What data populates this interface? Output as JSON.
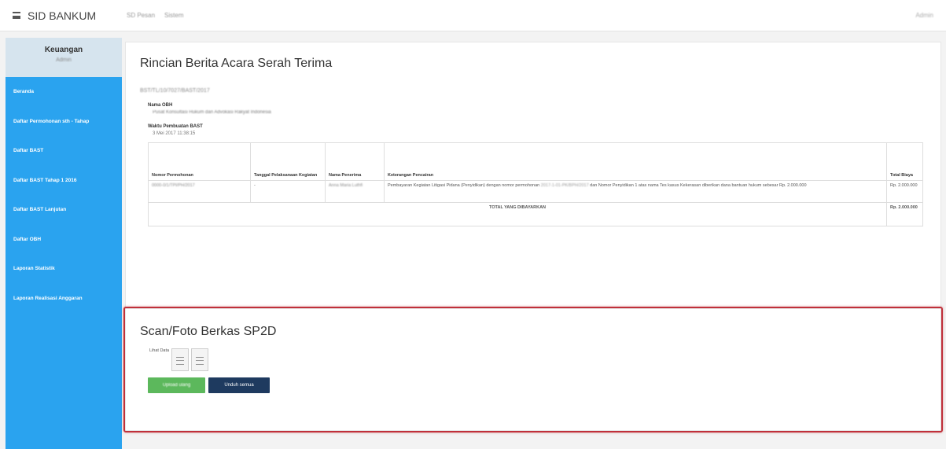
{
  "app": {
    "brand": "SID BANKUM"
  },
  "topnav": {
    "items": [
      "SD Pesan",
      "Sistem"
    ]
  },
  "user": {
    "name": "Admin"
  },
  "sidebar": {
    "title": "Keuangan",
    "subtitle": "Admin",
    "items": [
      {
        "label": "Beranda"
      },
      {
        "label": "Daftar Permohonan sth - Tahap"
      },
      {
        "label": "Daftar BAST"
      },
      {
        "label": "Daftar BAST Tahap 1 2016"
      },
      {
        "label": "Daftar BAST Lanjutan"
      },
      {
        "label": "Daftar OBH"
      },
      {
        "label": "Laporan Statistik"
      },
      {
        "label": "Laporan Realisasi Anggaran"
      }
    ]
  },
  "detail": {
    "title": "Rincian Berita Acara Serah Terima",
    "reference": "BST/TL/10/7027/BAST/2017",
    "obh_label": "Nama OBH",
    "obh_value": "Pusat Konsultasi Hukum dan Advokasi Rakyat Indonesia",
    "time_label": "Waktu Pembuatan BAST",
    "time_value": "3 Mei 2017 11:38:15",
    "table": {
      "headers": [
        "Nomor Permohonan",
        "Tanggal Pelaksanaan Kegiatan",
        "Nama Penerima",
        "Keterangan Pencairan",
        "Total Biaya"
      ],
      "rows": [
        {
          "nomor": "0000-0/1/TPI/PH/2017",
          "tanggal": "-",
          "penerima": "Anna Maria Luthfi",
          "keterangan_before": "Pembayaran Kegiatan Litigasi Pidana (Penyidikan) dengan nomor permohonan",
          "keterangan_blurred": "2017-1-01-PK/BPH/2017",
          "keterangan_after": "dan Nomor Penyidikan 1 atas nama Tes kasus Kekerasan diberikan dana bantuan hukum sebesar Rp. 2.000.000",
          "total": "Rp. 2.000.000"
        }
      ],
      "total_label": "TOTAL YANG DIBAYARKAN",
      "total_value": "Rp. 2.000.000"
    }
  },
  "scan": {
    "title": "Scan/Foto Berkas SP2D",
    "file_label": "Lihat Data",
    "upload_label": "Upload ulang",
    "download_label": "Unduh semua"
  }
}
